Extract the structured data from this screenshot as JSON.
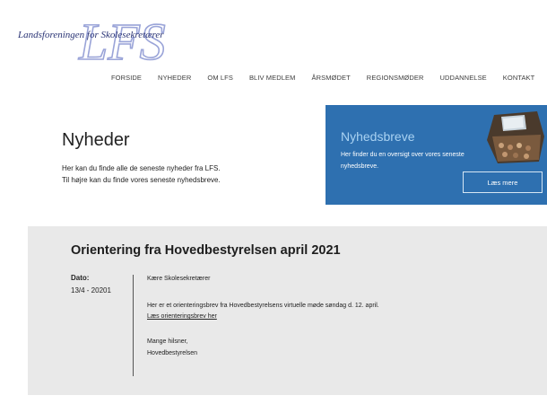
{
  "header": {
    "logo_text": "Landsforeningen for Skolesekretærer",
    "logo_letters": "LFS"
  },
  "nav": {
    "items": [
      "FORSIDE",
      "NYHEDER",
      "OM LFS",
      "BLIV MEDLEM",
      "ÅRSMØDET",
      "REGIONSMØDER",
      "UDDANNELSE",
      "KONTAKT"
    ]
  },
  "main": {
    "title": "Nyheder",
    "intro_line1": "Her kan du finde alle de seneste nyheder fra LFS.",
    "intro_line2": "Til højre kan du finde vores seneste nyhedsbreve."
  },
  "promo": {
    "title": "Nyhedsbreve",
    "text": "Her finder du en oversigt over vores seneste nyhedsbreve.",
    "button_label": "Læs mere"
  },
  "article": {
    "title": "Orientering fra Hovedbestyrelsen april 2021",
    "date_label": "Dato:",
    "date_value": "13/4 - 20201",
    "greeting": "Kære Skolesekretærer",
    "paragraph": "Her er et orienteringsbrev fra Hovedbestyrelsens virtuelle møde søndag d. 12. april.",
    "link_text": "Læs orienteringsbrev her",
    "closing1": "Mange hilsner,",
    "closing2": "Hovedbestyrelsen"
  },
  "colors": {
    "promo_bg": "#2e70b0",
    "article_bg": "#e9e9e9",
    "logo": "#2a3475"
  }
}
